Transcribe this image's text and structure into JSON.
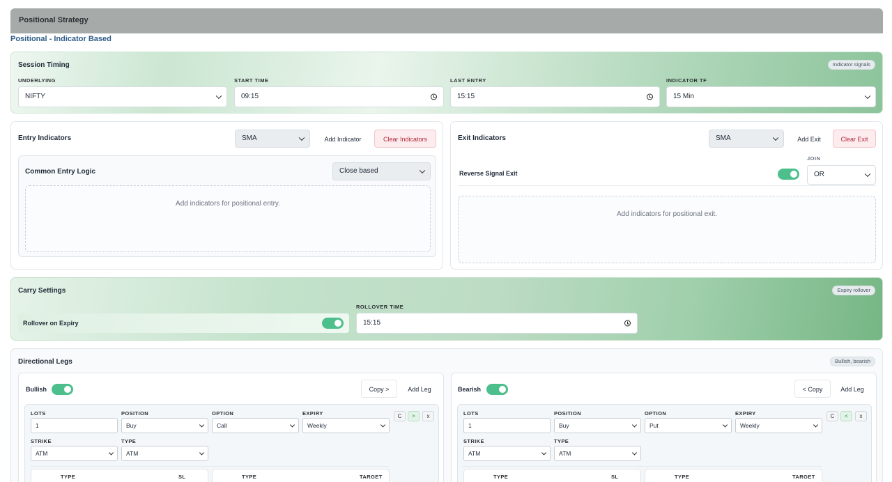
{
  "header": {
    "title": "Positional Strategy",
    "subtitle": "Positional - Indicator Based"
  },
  "session": {
    "title": "Session Timing",
    "badge": "Indicator signals",
    "underlying_label": "UNDERLYING",
    "underlying_value": "NIFTY",
    "start_label": "START TIME",
    "start_value": "09:15",
    "last_entry_label": "LAST ENTRY",
    "last_entry_value": "15:15",
    "tf_label": "INDICATOR TF",
    "tf_value": "15 Min"
  },
  "entry": {
    "title": "Entry Indicators",
    "indicator_select": "SMA",
    "add_label": "Add Indicator",
    "clear_label": "Clear Indicators",
    "logic_title": "Common Entry Logic",
    "logic_value": "Close based",
    "empty_text": "Add indicators for positional entry."
  },
  "exit": {
    "title": "Exit Indicators",
    "indicator_select": "SMA",
    "add_label": "Add Exit",
    "clear_label": "Clear Exit",
    "reverse_label": "Reverse Signal Exit",
    "join_label": "JOIN",
    "join_value": "OR",
    "empty_text": "Add indicators for positional exit."
  },
  "carry": {
    "title": "Carry Settings",
    "badge": "Expiry rollover",
    "rollover_label": "Rollover on Expiry",
    "time_label": "ROLLOVER TIME",
    "time_value": "15:15"
  },
  "legs": {
    "title": "Directional Legs",
    "badge": "Bullish, bearish",
    "bull": {
      "name": "Bullish",
      "copy_label": "Copy >",
      "add_label": "Add Leg",
      "lots_label": "LOTS",
      "lots_value": "1",
      "position_label": "POSITION",
      "position_value": "Buy",
      "option_label": "OPTION",
      "option_value": "Call",
      "expiry_label": "EXPIRY",
      "expiry_value": "Weekly",
      "strike_label": "STRIKE",
      "strike_value": "ATM",
      "type_label": "TYPE",
      "type_value": "ATM",
      "btn_c": "C",
      "btn_arrow": ">",
      "btn_x": "x",
      "sl_type_label": "TYPE",
      "sl_label": "SL",
      "tgt_type_label": "TYPE",
      "tgt_label": "TARGET"
    },
    "bear": {
      "name": "Bearish",
      "copy_label": "< Copy",
      "add_label": "Add Leg",
      "lots_label": "LOTS",
      "lots_value": "1",
      "position_label": "POSITION",
      "position_value": "Buy",
      "option_label": "OPTION",
      "option_value": "Put",
      "expiry_label": "EXPIRY",
      "expiry_value": "Weekly",
      "strike_label": "STRIKE",
      "strike_value": "ATM",
      "type_label": "TYPE",
      "type_value": "ATM",
      "btn_c": "C",
      "btn_arrow": "<",
      "btn_x": "x",
      "sl_type_label": "TYPE",
      "sl_label": "SL",
      "tgt_type_label": "TYPE",
      "tgt_label": "TARGET"
    }
  }
}
